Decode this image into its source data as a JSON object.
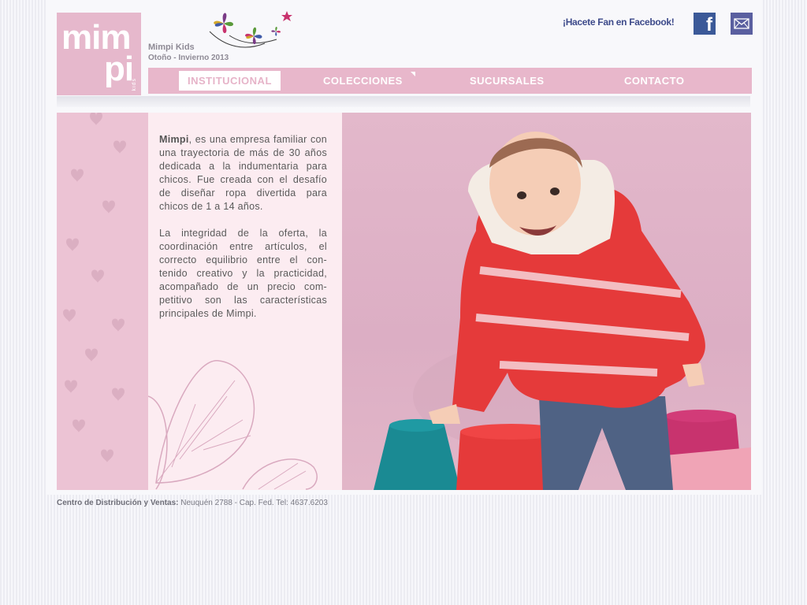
{
  "logo": {
    "line1": "mim",
    "line2": "pi",
    "line3": "kids"
  },
  "brand": {
    "name": "Mimpi Kids",
    "season": "Otoño - Invierno 2013"
  },
  "social": {
    "facebook_text": "¡Hacete Fan en Facebook!",
    "facebook_letter": "f"
  },
  "nav": {
    "items": [
      {
        "label": "INSTITUCIONAL",
        "active": true
      },
      {
        "label": "COLECCIONES"
      },
      {
        "label": "SUCURSALES"
      },
      {
        "label": "CONTACTO"
      }
    ]
  },
  "content": {
    "p1_brand": "Mimpi",
    "p1_rest": ", es una empresa familiar con una trayectoria de más de 30 años dedicada a la indumentaria para chicos. Fue creada con el desafío de diseñar ropa divertida para chicos de 1 a 14 años.",
    "p2": "La integridad de la oferta, la coordinación entre artículos, el correcto equilibrio entre el con-tenido creativo y la practicidad, acompañado de un precio com-petitivo son las características principales de Mimpi."
  },
  "footer": {
    "label": "Centro de Distribución y Ventas:",
    "address": " Neuquén 2788 - Cap. Fed. Tel: 4637.6203"
  },
  "colors": {
    "pink": "#e8b7cb",
    "nav_text": "#ffffff",
    "facebook": "#3b5998"
  }
}
